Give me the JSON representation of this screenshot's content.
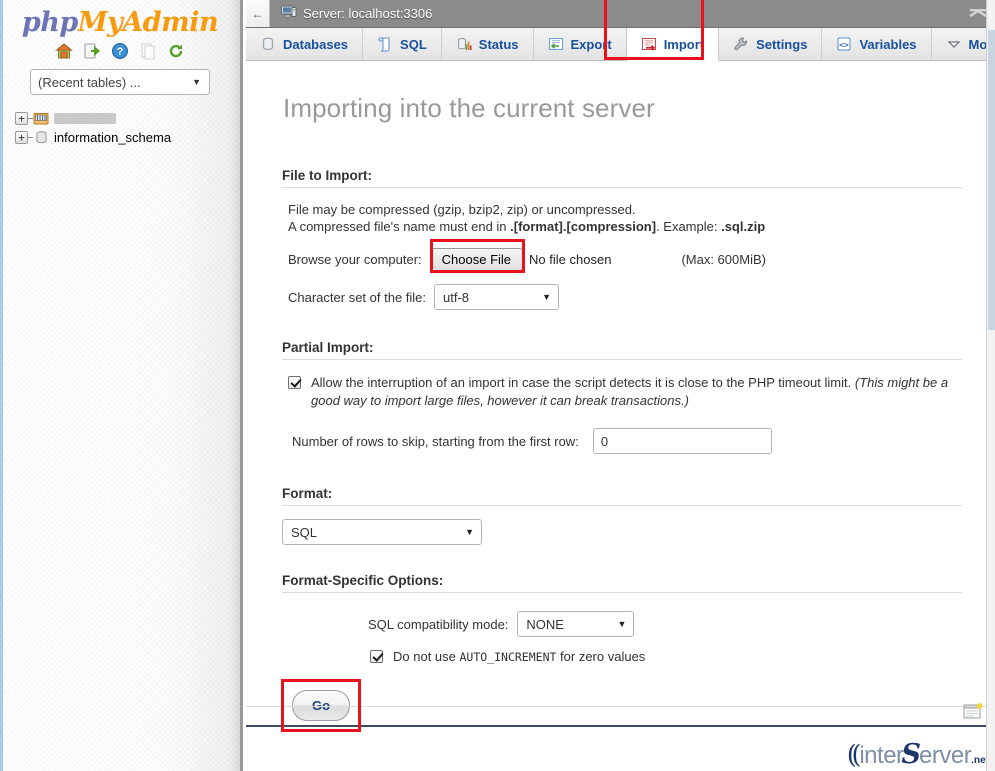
{
  "sidebar": {
    "logo": {
      "php": "php",
      "my": "My",
      "admin": "Admin"
    },
    "nav_icons": [
      {
        "name": "home-icon",
        "title": "Home"
      },
      {
        "name": "logout-icon",
        "title": "Log out"
      },
      {
        "name": "help-icon",
        "title": "phpMyAdmin documentation"
      },
      {
        "name": "docs-icon",
        "title": "Documentation"
      },
      {
        "name": "reload-icon",
        "title": "Reload navigation"
      }
    ],
    "recent_select": {
      "value": "(Recent tables) ...",
      "caret": "▼"
    },
    "tree": [
      {
        "name": "",
        "redacted": true,
        "icon": "database-table-icon",
        "expander": "+"
      },
      {
        "name": "information_schema",
        "redacted": false,
        "icon": "database-icon",
        "expander": "+"
      }
    ]
  },
  "serverbar": {
    "back_label": "←",
    "icon": "server-monitor-icon",
    "title": "Server: localhost:3306",
    "collapse_icon": "collapse-up-icon"
  },
  "tabs": [
    {
      "label": "Databases",
      "icon": "database-icon",
      "active": false
    },
    {
      "label": "SQL",
      "icon": "sql-scroll-icon",
      "active": false
    },
    {
      "label": "Status",
      "icon": "status-chart-icon",
      "active": false
    },
    {
      "label": "Export",
      "icon": "export-icon",
      "active": false
    },
    {
      "label": "Import",
      "icon": "import-icon",
      "active": true
    },
    {
      "label": "Settings",
      "icon": "wrench-icon",
      "active": false
    },
    {
      "label": "Variables",
      "icon": "code-brackets-icon",
      "active": false
    },
    {
      "label": "More",
      "icon": "chevron-down-icon",
      "active": false
    }
  ],
  "main": {
    "page_title": "Importing into the current server",
    "file_to_import": {
      "legend": "File to Import:",
      "note_line1": "File may be compressed (gzip, bzip2, zip) or uncompressed.",
      "note_line2_a": "A compressed file's name must end in ",
      "note_line2_b": ".[format].[compression]",
      "note_line2_c": ". Example: ",
      "note_line2_d": ".sql.zip",
      "browse_label": "Browse your computer:",
      "choose_file_button": "Choose File",
      "file_status": "No file chosen",
      "max_size": "(Max: 600MiB)",
      "charset_label": "Character set of the file:",
      "charset_value": "utf-8",
      "caret": "▼"
    },
    "partial_import": {
      "legend": "Partial Import:",
      "allow_interrupt_checked": true,
      "allow_interrupt_text": "Allow the interruption of an import in case the script detects it is close to the PHP timeout limit.",
      "allow_interrupt_italic": "(This might be a good way to import large files, however it can break transactions.)",
      "skip_label": "Number of rows to skip, starting from the first row:",
      "skip_value": "0"
    },
    "format": {
      "legend": "Format:",
      "value": "SQL",
      "caret": "▼"
    },
    "format_specific": {
      "legend": "Format-Specific Options:",
      "compat_label": "SQL compatibility mode:",
      "compat_value": "NONE",
      "caret": "▼",
      "auto_increment_checked": true,
      "auto_increment_text_a": "Do not use ",
      "auto_increment_text_mono": "AUTO_INCREMENT",
      "auto_increment_text_b": " for zero values"
    },
    "go_button": "Go"
  },
  "footer": {
    "console_icon": "console-icon",
    "brand": {
      "swoosh": "((",
      "part1": "inter",
      "s": "S",
      "part2": "erver",
      "tld": ".net"
    }
  },
  "highlights": [
    {
      "name": "import-tab-highlight"
    },
    {
      "name": "choose-file-highlight"
    },
    {
      "name": "go-button-highlight"
    }
  ],
  "colors": {
    "highlight_red": "#e8131a",
    "tab_link_blue": "#17519e",
    "title_gray": "#999999",
    "serverbar_gray": "#8b8b8b",
    "logo_purple": "#6c74b5",
    "logo_orange": "#f79a0e"
  }
}
